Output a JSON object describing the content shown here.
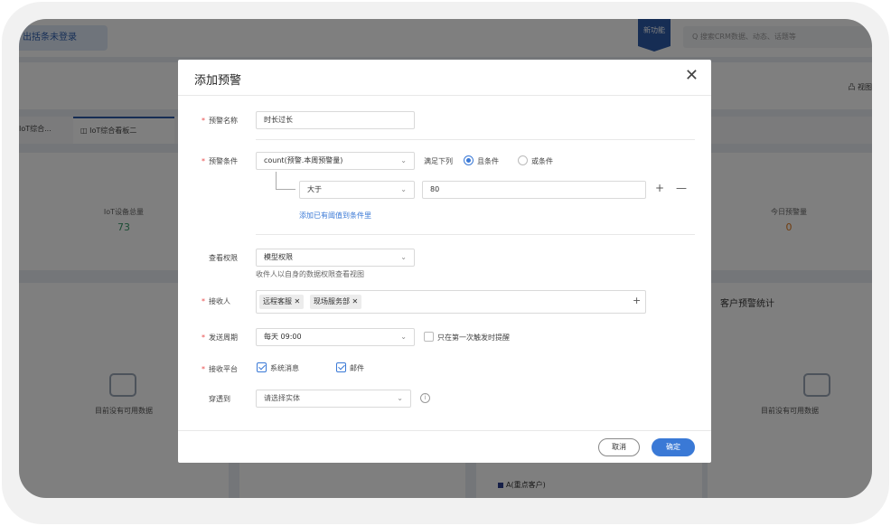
{
  "app": {
    "login_label": "出括条未登录",
    "new_feature_badge": "新功能",
    "search_placeholder": "Q 搜索CRM数据、动态、话题等",
    "view_label": "凸 视图",
    "tabs": [
      "IoT综合...",
      "IoT综合看板二"
    ],
    "stats": [
      {
        "label": "IoT设备总量",
        "value": "73",
        "color": "#3a9b6a"
      },
      {
        "label": "今日预警量",
        "value": "0",
        "color": "#e07a1f"
      }
    ],
    "panels": [
      {
        "title": "",
        "empty": "目前没有可用数据"
      },
      {
        "title": "客户预警统计",
        "empty": "目前没有可用数据"
      }
    ],
    "legend": "A(重点客户)"
  },
  "dialog": {
    "title": "添加预警",
    "close_icon": "close-icon",
    "name_label": "预警名称",
    "name_value": "时长过长",
    "condition_label": "预警条件",
    "condition_field": "count(预警.本周预警量)",
    "satisfy_text": "满足下列",
    "and_label": "且条件",
    "or_label": "或条件",
    "operator": "大于",
    "threshold": "80",
    "add_threshold_link": "添加已有阈值到条件里",
    "permission_label": "查看权限",
    "permission_value": "模型权限",
    "permission_hint": "收件人以自身的数据权限查看视图",
    "receiver_label": "接收人",
    "receivers": [
      "远程客服",
      "现场服务部"
    ],
    "period_label": "发送周期",
    "period_value": "每天 09:00",
    "first_trigger_label": "只在第一次触发时提醒",
    "platform_label": "接收平台",
    "platform_system": "系统消息",
    "platform_mail": "邮件",
    "penetrate_label": "穿透到",
    "penetrate_placeholder": "请选择实体",
    "cancel_label": "取消",
    "ok_label": "确定",
    "accent": "#3a79d6",
    "required_color": "#e84b4b"
  }
}
